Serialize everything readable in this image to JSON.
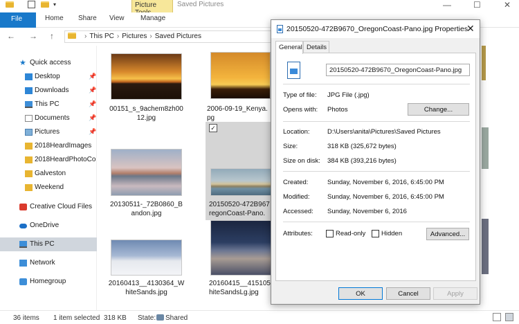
{
  "window": {
    "title": "Saved Pictures",
    "context_tab": "Picture Tools",
    "minimize": "—",
    "maximize": "☐",
    "close": "✕"
  },
  "ribbon": {
    "tabs": [
      "File",
      "Home",
      "Share",
      "View",
      "Manage"
    ]
  },
  "address": {
    "back": "←",
    "forward": "→",
    "up": "↑",
    "crumbs": [
      "This PC",
      "Pictures",
      "Saved Pictures"
    ]
  },
  "sidebar": {
    "items": [
      {
        "label": "Quick access",
        "icon": "star-icon",
        "pinned": false
      },
      {
        "label": "Desktop",
        "icon": "desktop-icon",
        "pinned": true
      },
      {
        "label": "Downloads",
        "icon": "download-icon",
        "pinned": true
      },
      {
        "label": "This PC",
        "icon": "computer-icon",
        "pinned": true
      },
      {
        "label": "Documents",
        "icon": "documents-icon",
        "pinned": true
      },
      {
        "label": "Pictures",
        "icon": "pictures-icon",
        "pinned": true
      },
      {
        "label": "2018HeardImages",
        "icon": "folder-icon",
        "pinned": false
      },
      {
        "label": "2018HeardPhotoCo",
        "icon": "folder-icon",
        "pinned": false
      },
      {
        "label": "Galveston",
        "icon": "folder-icon",
        "pinned": false
      },
      {
        "label": "Weekend",
        "icon": "folder-icon",
        "pinned": false
      },
      {
        "label": "Creative Cloud Files",
        "icon": "creative-cloud-icon",
        "pinned": false
      },
      {
        "label": "OneDrive",
        "icon": "cloud-icon",
        "pinned": false
      },
      {
        "label": "This PC",
        "icon": "computer-icon",
        "pinned": false
      },
      {
        "label": "Network",
        "icon": "network-icon",
        "pinned": false
      },
      {
        "label": "Homegroup",
        "icon": "homegroup-icon",
        "pinned": false
      }
    ],
    "pin_glyph": "📌"
  },
  "files": [
    {
      "line1": "00151_s_9achem8zh00",
      "line2": "12.jpg"
    },
    {
      "line1": "2006-09-19_Kenya.",
      "line2": "pg"
    },
    {
      "line1": "20130511-_72B0860_B",
      "line2": "andon.jpg"
    },
    {
      "line1": "20150520-472B967",
      "line2": "regonCoast-Pano."
    },
    {
      "line1": "20160413__4130364_W",
      "line2": "hiteSands.jpg"
    },
    {
      "line1": "20160415__415105",
      "line2": "hiteSandsLg.jpg"
    }
  ],
  "tile_check": "✓",
  "status": {
    "count": "36 items",
    "selected": "1 item selected",
    "size": "318 KB",
    "state_label": "State:",
    "state_value": "Shared"
  },
  "dialog": {
    "title": "20150520-472B9670_OregonCoast-Pano.jpg Properties",
    "close": "✕",
    "tabs": [
      "General",
      "Details"
    ],
    "filename": "20150520-472B9670_OregonCoast-Pano.jpg",
    "type_label": "Type of file:",
    "type_value": "JPG File (.jpg)",
    "opens_label": "Opens with:",
    "opens_value": "Photos",
    "change_btn": "Change...",
    "location_label": "Location:",
    "location_value": "D:\\Users\\anita\\Pictures\\Saved Pictures",
    "size_label": "Size:",
    "size_value": "318 KB (325,672 bytes)",
    "sizeondisk_label": "Size on disk:",
    "sizeondisk_value": "384 KB (393,216 bytes)",
    "created_label": "Created:",
    "created_value": "Sunday, November 6, 2016, 6:45:00 PM",
    "modified_label": "Modified:",
    "modified_value": "Sunday, November 6, 2016, 6:45:00 PM",
    "accessed_label": "Accessed:",
    "accessed_value": "Sunday, November 6, 2016",
    "attributes_label": "Attributes:",
    "readonly_label": "Read-only",
    "hidden_label": "Hidden",
    "advanced_btn": "Advanced...",
    "ok_btn": "OK",
    "cancel_btn": "Cancel",
    "apply_btn": "Apply"
  }
}
